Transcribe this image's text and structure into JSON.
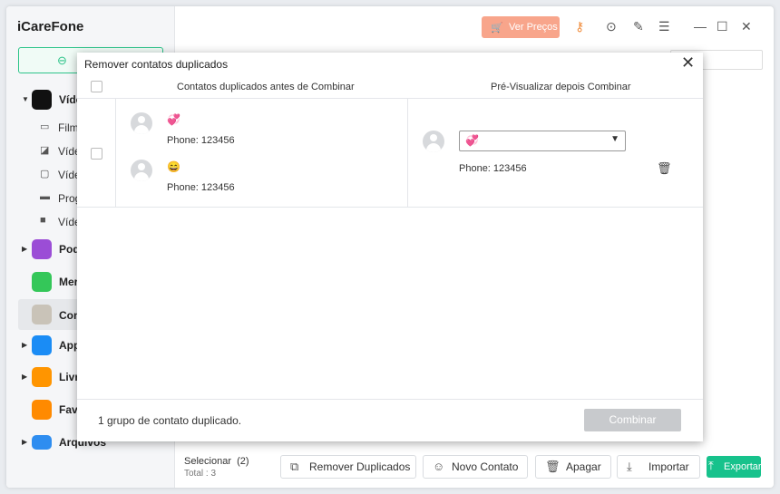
{
  "app": {
    "title": "iCareFone"
  },
  "sidebar": {
    "back_label": "⊖",
    "items": [
      {
        "label": "Víde",
        "icon": "tv-app-icon",
        "color": "#111111",
        "expanded": true
      },
      {
        "label": "Filme",
        "icon": "film-icon"
      },
      {
        "label": "Víde",
        "icon": "video-icon"
      },
      {
        "label": "Víde",
        "icon": "monitor-icon"
      },
      {
        "label": "Prog",
        "icon": "tv-show-icon"
      },
      {
        "label": "Víde",
        "icon": "camera-icon"
      },
      {
        "label": "Pod",
        "icon": "podcast-icon",
        "color": "#9b4dd6"
      },
      {
        "label": "Mer",
        "icon": "messages-icon",
        "color": "#34c759"
      },
      {
        "label": "Con",
        "icon": "contacts-icon",
        "color": "#c9c3b8"
      },
      {
        "label": "App",
        "icon": "app-store-icon",
        "color": "#1a8cf5"
      },
      {
        "label": "Livr",
        "icon": "books-icon",
        "color": "#ff9500"
      },
      {
        "label": "Fave",
        "icon": "bookmark-icon",
        "color": "#ff8a00"
      },
      {
        "label": "Arquivos",
        "icon": "folder-icon",
        "color": "#2e8df0"
      }
    ]
  },
  "topbar": {
    "price_button": "Ver Preços"
  },
  "bottombar": {
    "select_label": "Selecionar",
    "select_count": "(2)",
    "total": "Total : 3",
    "remove_duplicates": "Remover Duplicados",
    "new_contact": "Novo Contato",
    "delete": "Apagar",
    "import": "Importar",
    "export": "Exportar"
  },
  "modal": {
    "title": "Remover contatos duplicados",
    "col_before": "Contatos duplicados antes de Combinar",
    "col_after": "Pré-Visualizar depois Combinar",
    "before": [
      {
        "name": "💞",
        "phone": "Phone: 123456"
      },
      {
        "name": "😄",
        "phone": "Phone: 123456"
      }
    ],
    "after": {
      "selected_name": "💞",
      "phone": "Phone: 123456"
    },
    "footer_text": "1 grupo de contato duplicado.",
    "combine_button": "Combinar"
  },
  "colors": {
    "accent": "#17c28c",
    "price": "#f8a58b",
    "disabled": "#c8cacd"
  }
}
